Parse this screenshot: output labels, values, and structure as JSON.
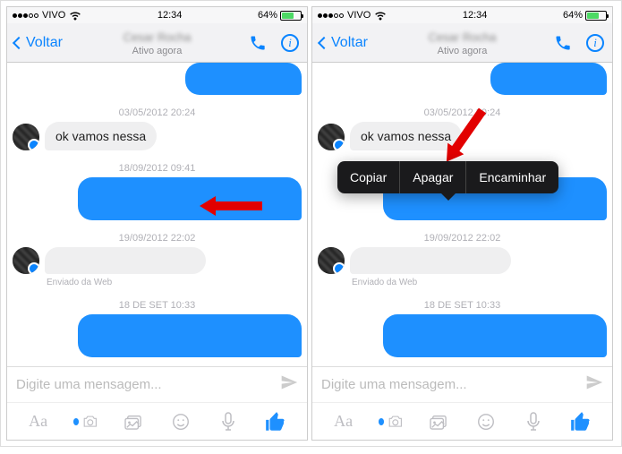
{
  "statusbar": {
    "carrier": "VIVO",
    "time": "12:34",
    "battery": "64%"
  },
  "header": {
    "back": "Voltar",
    "contact": "Cesar Rocha",
    "substatus": "Ativo agora"
  },
  "chat": {
    "ts1": "03/05/2012 20:24",
    "msg_in_1": "ok vamos nessa",
    "ts2": "18/09/2012 09:41",
    "ts3": "19/09/2012 22:02",
    "caption_web": "Enviado da Web",
    "ts4": "18 DE SET 10:33"
  },
  "context_menu": {
    "copy": "Copiar",
    "delete": "Apagar",
    "forward": "Encaminhar"
  },
  "input": {
    "placeholder": "Digite uma mensagem..."
  },
  "toolbar": {
    "aa": "Aa"
  }
}
